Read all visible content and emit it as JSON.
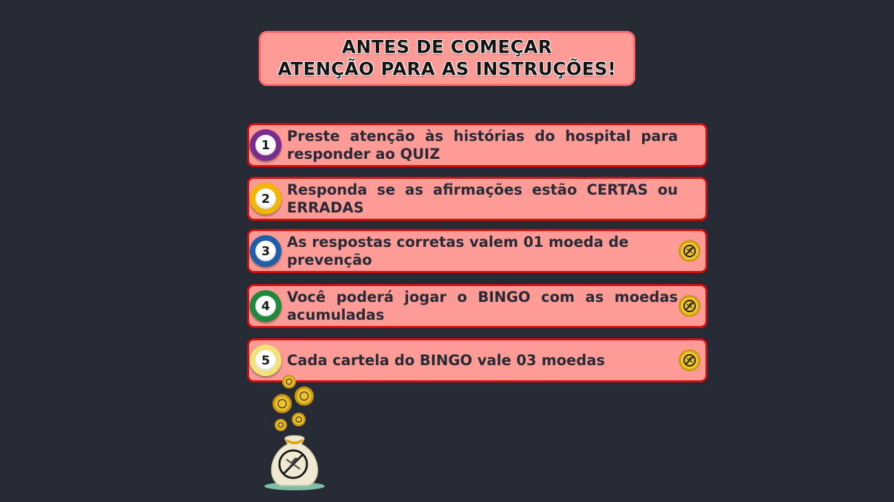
{
  "header": {
    "line1": "ANTES DE COMEÇAR",
    "line2": "ATENÇÃO PARA AS INSTRUÇÕES!"
  },
  "instructions": [
    {
      "number": "1",
      "text": "Preste atenção às histórias do hospital para responder ao QUIZ",
      "ball_color": "#7b2d8e",
      "coin": false
    },
    {
      "number": "2",
      "text": "Responda se as afirmações estão CERTAS ou ERRADAS",
      "ball_color": "#f2b705",
      "coin": false
    },
    {
      "number": "3",
      "text": "As respostas corretas valem 01 moeda de prevenção",
      "ball_color": "#1f5fa8",
      "coin": true
    },
    {
      "number": "4",
      "text": "Você poderá jogar o BINGO com as moedas acumuladas",
      "ball_color": "#1e8a3c",
      "coin": true
    },
    {
      "number": "5",
      "text": "Cada cartela do BINGO vale 03 moedas",
      "ball_color": "#f1e27a",
      "coin": true
    }
  ],
  "icons": {
    "coin": "no-mosquito-coin-icon",
    "bag": "money-bag-icon",
    "coin_color": "#e9b820"
  }
}
